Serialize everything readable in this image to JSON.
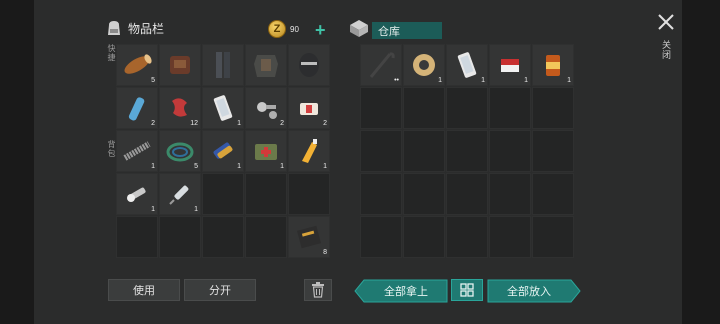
{
  "inventory": {
    "title": "物品栏",
    "coins": "90",
    "quick_label": "快捷",
    "bag_label": "背包",
    "rows": [
      [
        {
          "icon": "wood-log-icon",
          "qty": "5"
        },
        {
          "icon": "backpack-harness-icon",
          "qty": ""
        },
        {
          "icon": "leg-armor-icon",
          "qty": ""
        },
        {
          "icon": "body-armor-icon",
          "qty": ""
        },
        {
          "icon": "helmet-icon",
          "qty": ""
        }
      ],
      [
        {
          "icon": "water-bottle-icon",
          "qty": "2"
        },
        {
          "icon": "raw-meat-icon",
          "qty": "12"
        },
        {
          "icon": "smartphone-icon",
          "qty": "1"
        },
        {
          "icon": "bolts-nuts-icon",
          "qty": "2"
        },
        {
          "icon": "bandage-icon",
          "qty": "2"
        }
      ],
      [
        {
          "icon": "spring-coil-icon",
          "qty": "1"
        },
        {
          "icon": "rope-coil-icon",
          "qty": "5"
        },
        {
          "icon": "battery-icon",
          "qty": "1"
        },
        {
          "icon": "first-aid-kit-icon",
          "qty": "1"
        },
        {
          "icon": "glue-tube-icon",
          "qty": "1"
        }
      ],
      [
        {
          "icon": "flashlight-icon",
          "qty": "1"
        },
        {
          "icon": "syringe-icon",
          "qty": "1"
        },
        {
          "icon": "",
          "qty": ""
        },
        {
          "icon": "",
          "qty": ""
        },
        {
          "icon": "",
          "qty": ""
        }
      ],
      [
        {
          "icon": "",
          "qty": ""
        },
        {
          "icon": "",
          "qty": ""
        },
        {
          "icon": "",
          "qty": ""
        },
        {
          "icon": "",
          "qty": ""
        },
        {
          "icon": "notebook-icon",
          "qty": "8"
        }
      ]
    ],
    "use_label": "使用",
    "split_label": "分开"
  },
  "warehouse": {
    "title": "仓库",
    "rows": [
      [
        {
          "icon": "crowbar-icon",
          "qty": "••"
        },
        {
          "icon": "duct-tape-icon",
          "qty": "1"
        },
        {
          "icon": "smartphone-icon",
          "qty": "1"
        },
        {
          "icon": "cigarettes-icon",
          "qty": "1"
        },
        {
          "icon": "canned-food-icon",
          "qty": "1"
        }
      ],
      [
        {
          "icon": "",
          "qty": ""
        },
        {
          "icon": "",
          "qty": ""
        },
        {
          "icon": "",
          "qty": ""
        },
        {
          "icon": "",
          "qty": ""
        },
        {
          "icon": "",
          "qty": ""
        }
      ],
      [
        {
          "icon": "",
          "qty": ""
        },
        {
          "icon": "",
          "qty": ""
        },
        {
          "icon": "",
          "qty": ""
        },
        {
          "icon": "",
          "qty": ""
        },
        {
          "icon": "",
          "qty": ""
        }
      ],
      [
        {
          "icon": "",
          "qty": ""
        },
        {
          "icon": "",
          "qty": ""
        },
        {
          "icon": "",
          "qty": ""
        },
        {
          "icon": "",
          "qty": ""
        },
        {
          "icon": "",
          "qty": ""
        }
      ],
      [
        {
          "icon": "",
          "qty": ""
        },
        {
          "icon": "",
          "qty": ""
        },
        {
          "icon": "",
          "qty": ""
        },
        {
          "icon": "",
          "qty": ""
        },
        {
          "icon": "",
          "qty": ""
        }
      ]
    ],
    "take_all_label": "全部拿上",
    "put_all_label": "全部放入"
  },
  "close_label": "关闭",
  "colors": {
    "accent": "#2aa59a",
    "accent_dark": "#1f7a72",
    "coin": "#e8b93a"
  }
}
